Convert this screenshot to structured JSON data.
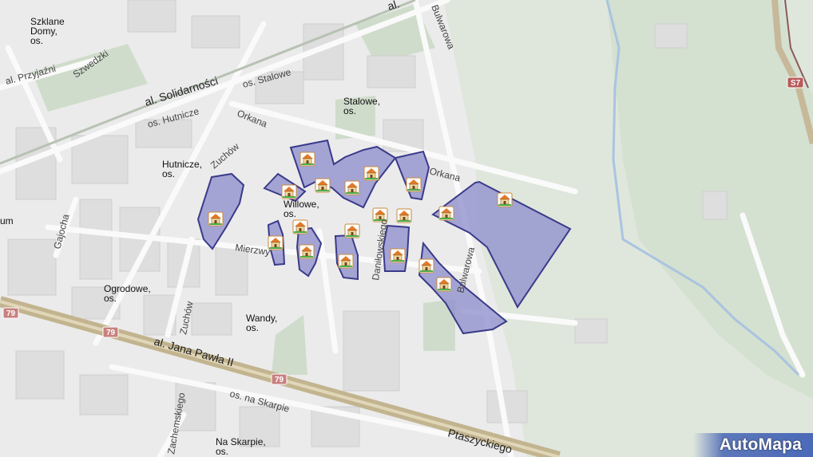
{
  "map": {
    "brand": "AutoMapa",
    "estate_labels": [
      {
        "line1": "Szklane",
        "line2": "Domy,",
        "line3": "os."
      },
      {
        "line1": "Stalowe,",
        "line2": "os."
      },
      {
        "line1": "Hutnicze,",
        "line2": "os."
      },
      {
        "line1": "Willowe,",
        "line2": "os."
      },
      {
        "line1": "Ogrodowe,",
        "line2": "os."
      },
      {
        "line1": "Wandy,",
        "line2": "os."
      },
      {
        "line1": "Na Skarpie,",
        "line2": "os."
      }
    ],
    "streets": {
      "solidarnosci": "al. Solidarności",
      "al_top": "al.",
      "przyjazni": "al. Przyjaźni",
      "szwedzki": "Szwedzki",
      "os_stalowe": "os. Stalowe",
      "os_hutnicze": "os. Hutnicze",
      "orkana_w": "Orkana",
      "orkana_e": "Orkana",
      "zuchow_n": "Zuchów",
      "zuchow_s": "Zuchów",
      "bulwarowa_n": "Bulwarowa",
      "bulwarowa_s": "Bulwarowa",
      "gajocha": "Gajocha",
      "mierzwy": "Mierzwy",
      "daniluki": "Daniłowskiego",
      "jana_pawla": "al. Jana Pawła II",
      "na_skarpie": "os. na Skarpie",
      "zachemskiego": "Zachemskiego",
      "ptaszyckiego": "Ptaszyckiego",
      "edge_um": "um"
    },
    "road_shields": [
      {
        "text": "79",
        "type": "national"
      },
      {
        "text": "79",
        "type": "national"
      },
      {
        "text": "79",
        "type": "national"
      },
      {
        "text": "S7",
        "type": "expressway"
      }
    ],
    "highlight_color": "#8c8ccc",
    "highlight_border": "#3a3a8a",
    "marker_icon": "house-icon",
    "marker_count": 20
  }
}
